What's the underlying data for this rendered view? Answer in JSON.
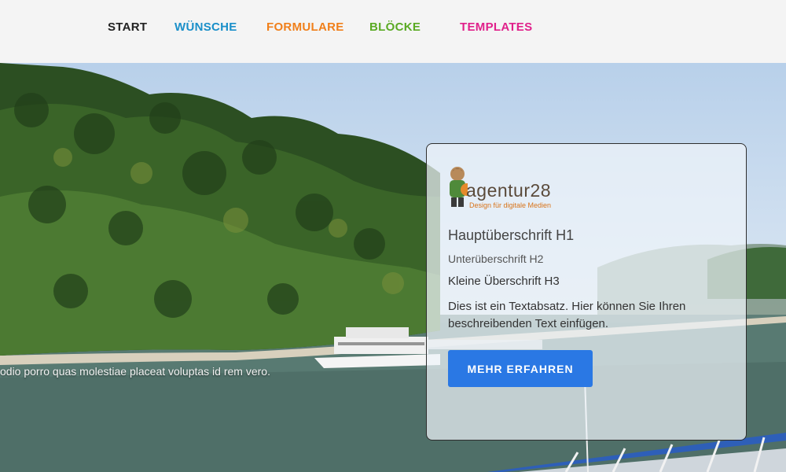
{
  "nav": {
    "items": [
      {
        "label": "START",
        "color": "#222222"
      },
      {
        "label": "WÜNSCHE",
        "color": "#1a8fc9"
      },
      {
        "label": "FORMULARE",
        "color": "#f07f1a"
      },
      {
        "label": "BLÖCKE",
        "color": "#5aaa23"
      },
      {
        "label": "TEMPLATES",
        "color": "#e0208a"
      }
    ]
  },
  "hero": {
    "ticker_text": "odio porro quas molestiae placeat voluptas id rem vero."
  },
  "card": {
    "logo": {
      "name": "agentur28",
      "tagline": "Design für digitale Medien",
      "icon": "mascot-icon"
    },
    "h1": "Hauptüberschrift H1",
    "h2": "Unterüberschrift H2",
    "h3": "Kleine Überschrift H3",
    "paragraph": "Dies ist ein Textabsatz. Hier können Sie Ihren beschreibenden Text einfügen.",
    "button_label": "MEHR ERFAHREN",
    "button_color": "#2a78e4"
  }
}
